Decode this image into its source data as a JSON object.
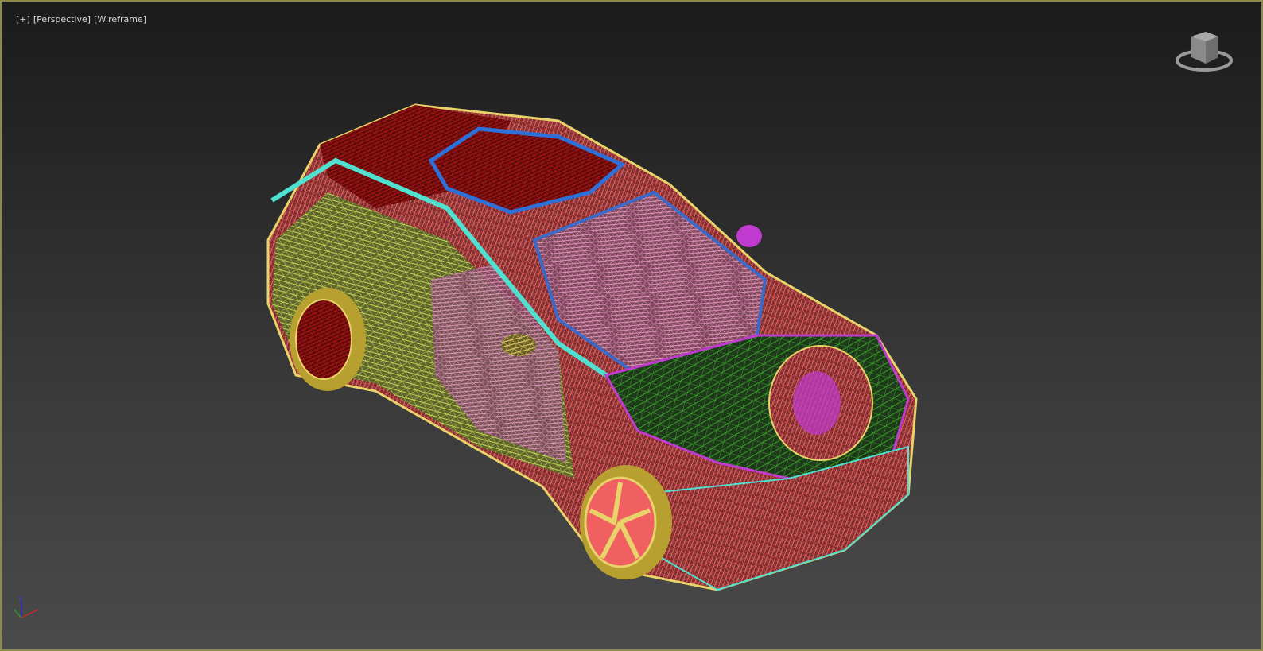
{
  "viewport": {
    "labels": {
      "plus": "[+]",
      "view": "[Perspective]",
      "shading": "[Wireframe]"
    },
    "border_color": "#8e8a4a",
    "axis_gizmo": {
      "z_label": "z"
    },
    "model_colors": [
      "#8b0e0e",
      "#e8d26a",
      "#4fe0d0",
      "#2f6fd8",
      "#f0a0d0",
      "#3aa02a",
      "#c8e85a",
      "#f06060",
      "#c03ad0",
      "#b8a030"
    ]
  }
}
